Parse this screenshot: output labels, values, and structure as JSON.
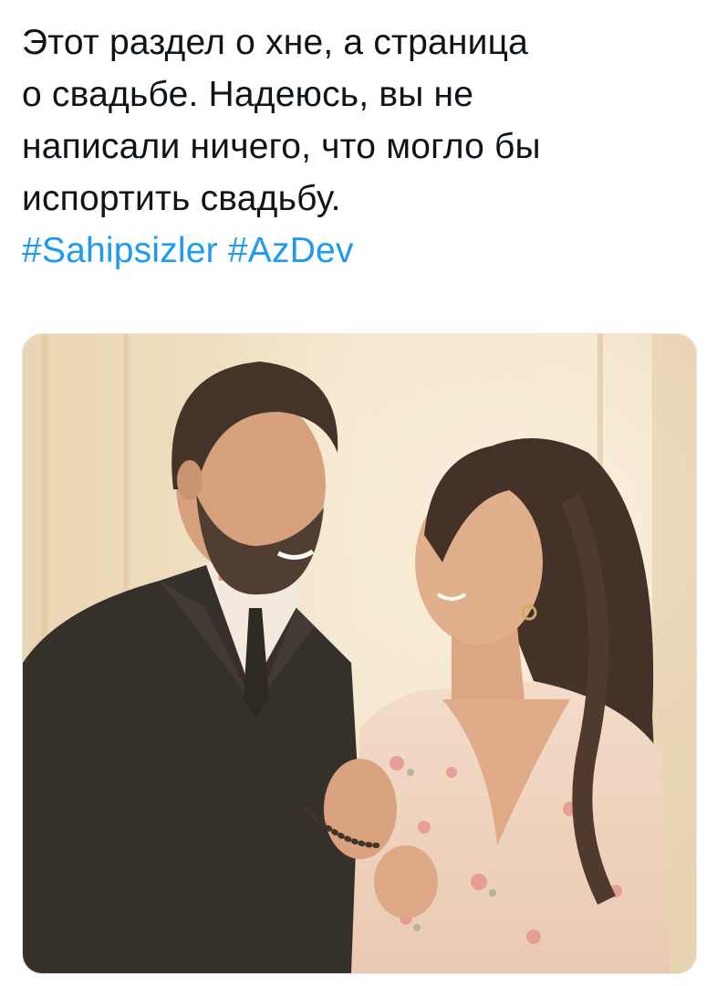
{
  "tweet": {
    "text_lines": [
      "Этот раздел о хне, а страница",
      "о свадьбе. Надеюсь, вы не",
      "написали ничего, что могло бы",
      "испортить свадьбу."
    ],
    "hashtags": [
      "#Sahipsizler",
      "#AzDev"
    ],
    "hashtag_separator": " "
  },
  "media": {
    "type": "photo",
    "subject": "couple-portrait"
  },
  "colors": {
    "text": "#0f1419",
    "hashtag": "#1d9bf0",
    "background": "#ffffff"
  }
}
